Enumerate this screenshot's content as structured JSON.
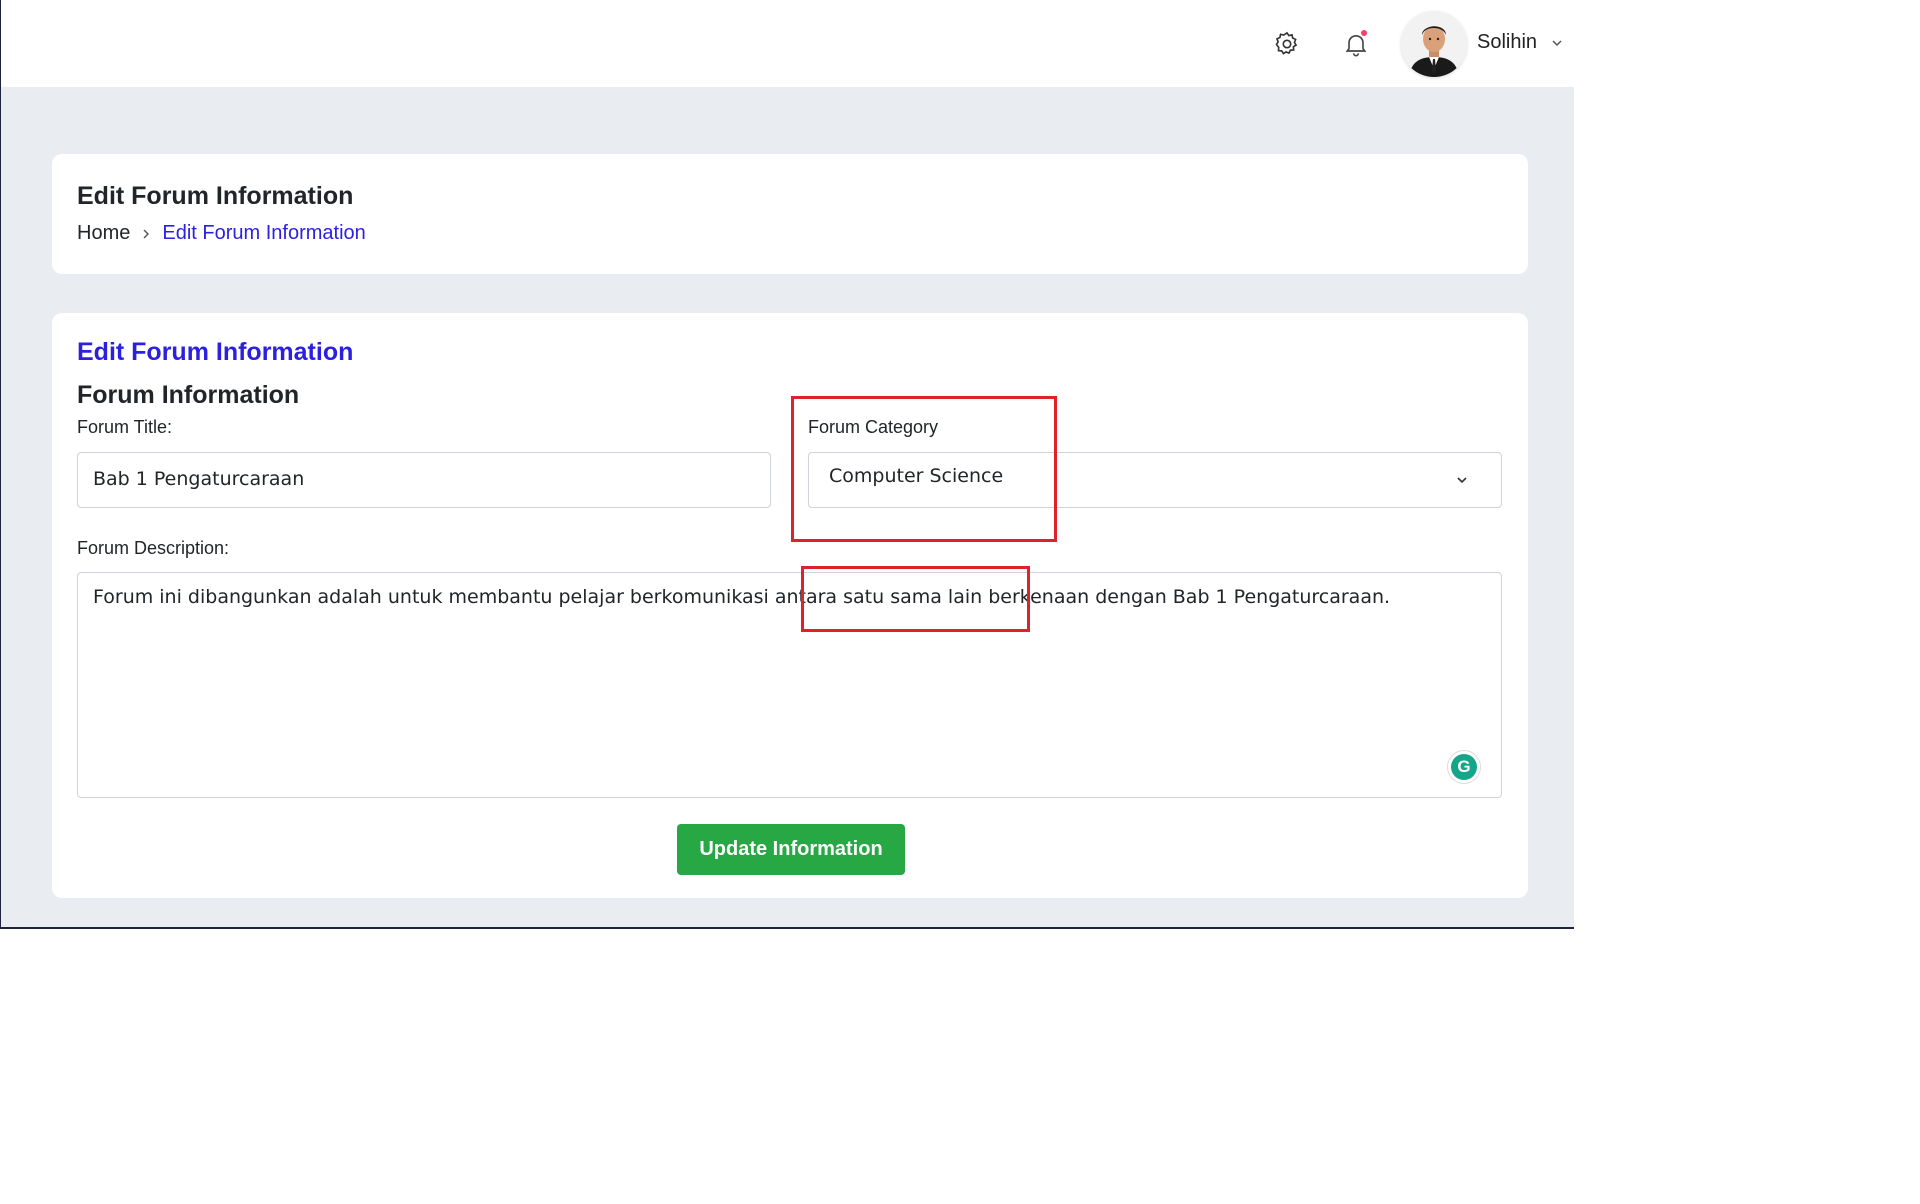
{
  "header": {
    "user_name": "Solihin",
    "icons": [
      "gear-icon",
      "bell-icon",
      "chevron-down-icon"
    ],
    "notification_dot_color": "#ff3b6b"
  },
  "page_header": {
    "title": "Edit Forum Information",
    "breadcrumb": {
      "home": "Home",
      "current": "Edit Forum Information"
    }
  },
  "form": {
    "card_title": "Edit Forum Information",
    "section_title": "Forum Information",
    "forum_title": {
      "label": "Forum Title:",
      "value": "Bab 1 Pengaturcaraan"
    },
    "forum_category": {
      "label": "Forum Category",
      "selected": "Computer Science"
    },
    "forum_description": {
      "label": "Forum Description:",
      "value": "Forum ini dibangunkan adalah untuk membantu pelajar berkomunikasi antara satu sama lain berkenaan dengan Bab 1 Pengaturcaraan."
    },
    "submit_label": "Update Information"
  },
  "colors": {
    "accent": "#2b1fe0",
    "button": "#28a745",
    "highlight": "#e0202a",
    "background": "#e9ecf0"
  }
}
